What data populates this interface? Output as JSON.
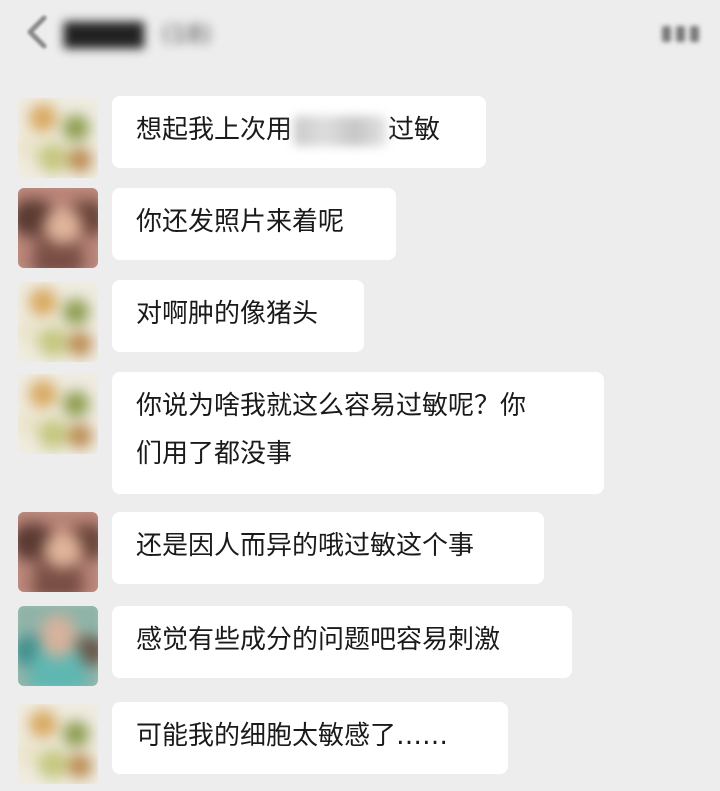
{
  "header": {
    "back_icon": "chevron-left-icon",
    "title": "▇▇▇▇",
    "member_count": "(18)",
    "more_icon": "more-icon"
  },
  "messages": [
    {
      "sender": "flower-avatar",
      "text_before": "想起我上次用",
      "text_redacted": "▇▇▇",
      "text_after": "过敏"
    },
    {
      "sender": "woman-avatar",
      "lines": [
        "你还发照片来着呢"
      ]
    },
    {
      "sender": "flower-avatar",
      "lines": [
        "对啊肿的像猪头"
      ]
    },
    {
      "sender": "flower-avatar",
      "lines": [
        "你说为啥我就这么容易过敏呢？你",
        "们用了都没事"
      ]
    },
    {
      "sender": "woman-avatar",
      "lines": [
        "还是因人而异的哦过敏这个事"
      ]
    },
    {
      "sender": "teal-avatar",
      "lines": [
        "感觉有些成分的问题吧容易刺激"
      ]
    },
    {
      "sender": "flower-avatar",
      "lines": [
        "可能我的细胞太敏感了……"
      ]
    }
  ]
}
